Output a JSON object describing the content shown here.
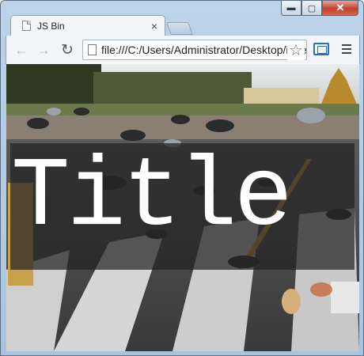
{
  "window": {
    "controls": {
      "minimize": "▬",
      "maximize": "▢",
      "close": "✕"
    }
  },
  "tab": {
    "title": "JS Bin",
    "close_icon": "×"
  },
  "toolbar": {
    "back_icon": "←",
    "forward_icon": "→",
    "reload_icon": "↻",
    "url": "file:///C:/Users/Administrator/Desktop/index.html",
    "star_icon": "☆"
  },
  "page": {
    "heading": "Title",
    "background_image": "pigeons-square-photo"
  },
  "colors": {
    "chrome_frame": "#bcd4ea",
    "close_button": "#c4432d",
    "overlay": "#232323",
    "heading_text": "#ffffff"
  }
}
